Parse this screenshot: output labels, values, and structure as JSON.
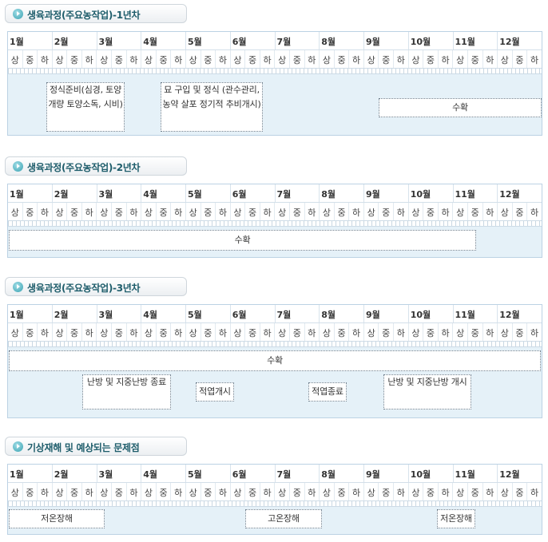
{
  "months": [
    "1월",
    "2월",
    "3월",
    "4월",
    "5월",
    "6월",
    "7월",
    "8월",
    "9월",
    "10월",
    "11월",
    "12월"
  ],
  "periods": [
    "상",
    "중",
    "하"
  ],
  "sections": [
    {
      "title": "생육과정(주요농작업)-1년차",
      "tasks": [
        "정식준비(심경, 토양개량 토양소독, 시비)",
        "묘 구입 및 정식 (관수관리, 농약 살포 정기적 추비개시)",
        "수확"
      ]
    },
    {
      "title": "생육과정(주요농작업)-2년차",
      "tasks": [
        "수확"
      ]
    },
    {
      "title": "생육과정(주요농작업)-3년차",
      "tasks": [
        "수확",
        "난방 및 지중난방 종료",
        "적엽개시",
        "적엽종료",
        "난방 및 지중난방 개시"
      ]
    },
    {
      "title": "기상재해 및 예상되는 문제점",
      "tasks": [
        "저온장해",
        "고온장해",
        "저온장해"
      ]
    }
  ]
}
